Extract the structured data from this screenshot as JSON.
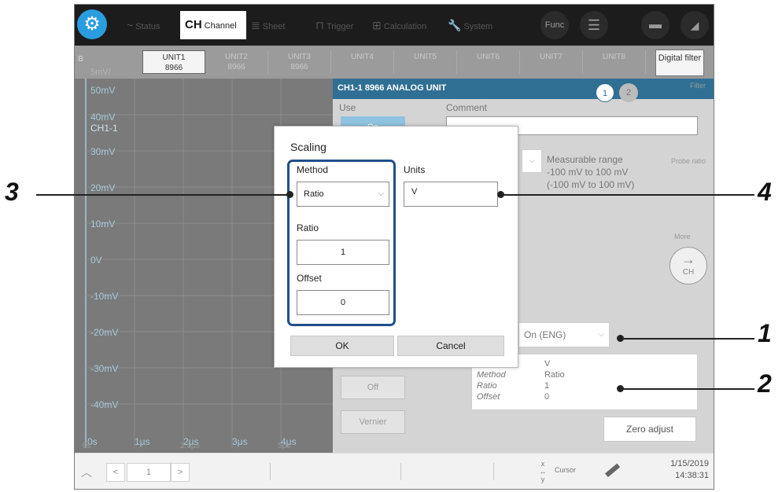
{
  "toolbar": {
    "tabs": [
      {
        "icon": "~",
        "label": "Status"
      },
      {
        "icon": "CH",
        "label": "Channel"
      },
      {
        "icon": "≣",
        "label": "Sheet"
      },
      {
        "icon": "⊓",
        "label": "Trigger"
      },
      {
        "icon": "⊞",
        "label": "Calculation"
      },
      {
        "icon": "🔧",
        "label": "System"
      }
    ],
    "func_label": "Func"
  },
  "unit_tabs": [
    {
      "name": "UNIT1",
      "model": "8966"
    },
    {
      "name": "UNIT2",
      "model": "8966"
    },
    {
      "name": "UNIT3",
      "model": "8966"
    },
    {
      "name": "UNIT4",
      "model": ""
    },
    {
      "name": "UNIT5",
      "model": ""
    },
    {
      "name": "UNIT6",
      "model": ""
    },
    {
      "name": "UNIT7",
      "model": ""
    },
    {
      "name": "UNIT8",
      "model": ""
    }
  ],
  "digital_filter_label": "Digital filter",
  "waveform": {
    "sheet_marker": "B",
    "scale_label": "5mV/",
    "channel_label": "CH1-1",
    "y_labels": [
      "50mV",
      "40mV",
      "30mV",
      "20mV",
      "10mV",
      "0V",
      "-10mV",
      "-20mV",
      "-30mV",
      "-40mV"
    ],
    "x_labels": [
      "0s",
      "1μs",
      "2μs",
      "3μs",
      "4μs"
    ],
    "x_ghost_labels": [
      "0s",
      "2.5μs",
      "5μs"
    ]
  },
  "panel": {
    "header": "CH1-1     8966 ANALOG UNIT",
    "pages": [
      "1",
      "2"
    ],
    "use_label": "Use",
    "use_value": "On",
    "comment_label": "Comment",
    "comment_value": "",
    "measurable_range_label": "Measurable range",
    "measurable_range_value": "-100 mV to 100 mV",
    "measurable_range_alt": "(-100 mV to 100 mV)",
    "scaling_select_value": "On (ENG)",
    "info": {
      "units_value": "V",
      "method_key": "Method",
      "method_value": "Ratio",
      "ratio_key": "Ratio",
      "ratio_value": "1",
      "offset_key": "Offset",
      "offset_value": "0"
    },
    "off_label": "Off",
    "vernier_label": "Vernier",
    "zero_adjust_label": "Zero adjust",
    "ch_label": "CH",
    "side_labels": {
      "filter": "Filter",
      "probe": "Probe ratio",
      "more": "More"
    }
  },
  "status_bar": {
    "page_value": "1",
    "cursor_label": "Cursor",
    "date": "1/15/2019",
    "time": "14:38:31"
  },
  "dialog": {
    "title": "Scaling",
    "method_label": "Method",
    "method_value": "Ratio",
    "units_label": "Units",
    "units_value": "V",
    "ratio_label": "Ratio",
    "ratio_value": "1",
    "offset_label": "Offset",
    "offset_value": "0",
    "ok_label": "OK",
    "cancel_label": "Cancel"
  },
  "callouts": [
    "3",
    "4",
    "1",
    "2"
  ],
  "colors": {
    "accent_blue": "#2a9de0",
    "panel_header": "#2f6f94",
    "highlight_border": "#1f4f8a",
    "waveform_bg": "#7a7a7a"
  }
}
